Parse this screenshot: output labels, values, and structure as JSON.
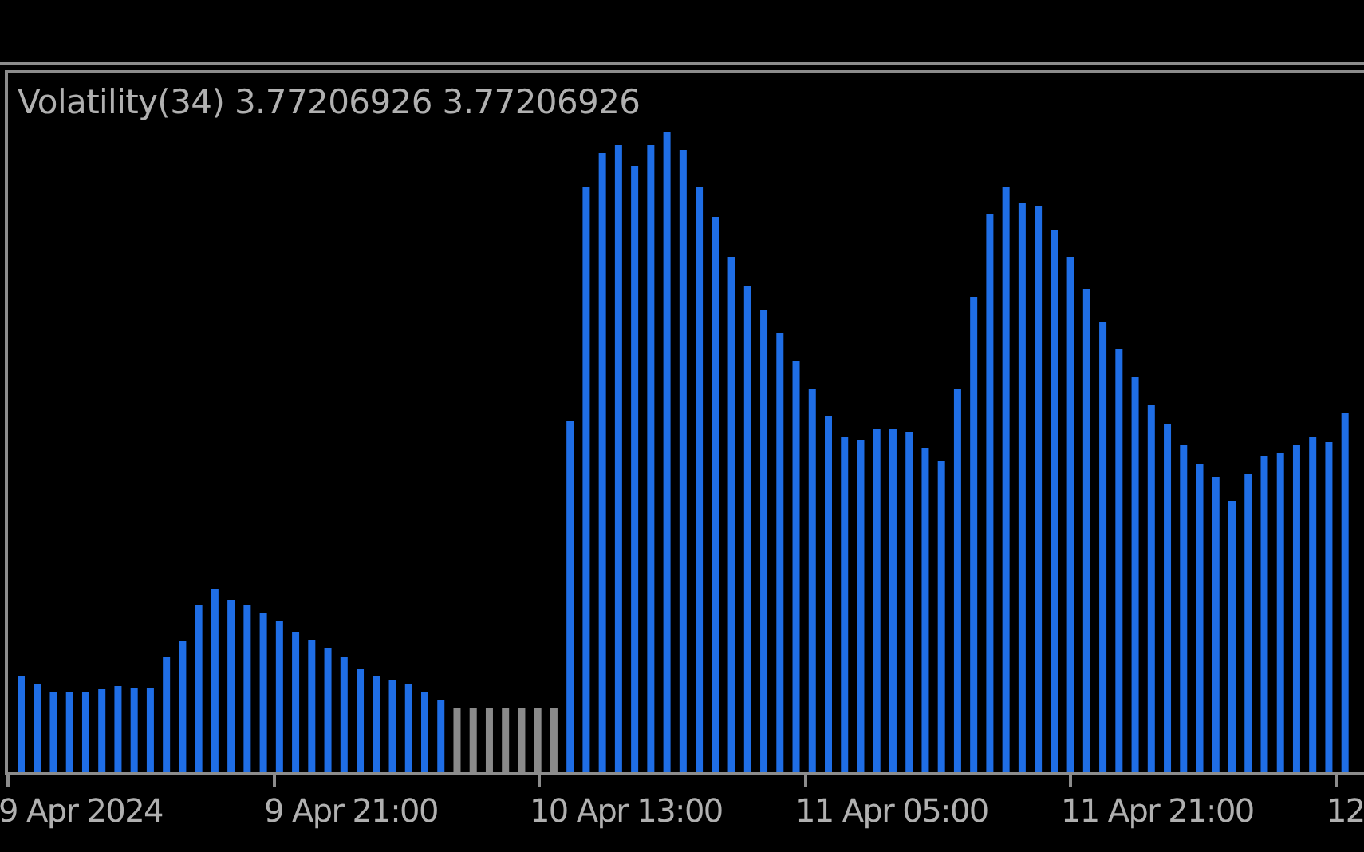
{
  "indicator": {
    "label": "Volatility(34) 3.77206926 3.77206926"
  },
  "time_axis": {
    "labels": [
      "9 Apr 2024",
      "9 Apr 21:00",
      "10 Apr 13:00",
      "11 Apr 05:00",
      "11 Apr 21:00",
      "12"
    ]
  }
}
